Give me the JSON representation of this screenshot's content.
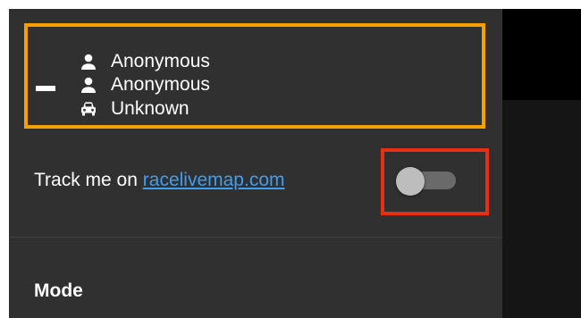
{
  "status": {
    "rows": [
      {
        "icon": "person-icon",
        "label": "Anonymous"
      },
      {
        "icon": "person-icon",
        "label": "Anonymous"
      },
      {
        "icon": "car-icon",
        "label": "Unknown"
      }
    ],
    "collapse_icon": "minus-icon"
  },
  "tracking": {
    "text": "Track me on ",
    "link": "racelivemap.com",
    "enabled": false
  },
  "mode": {
    "label": "Mode"
  },
  "colors": {
    "panel_background": "#303030",
    "highlight_orange": "#f5a000",
    "highlight_red": "#e53012",
    "link": "#3f9ef0"
  }
}
